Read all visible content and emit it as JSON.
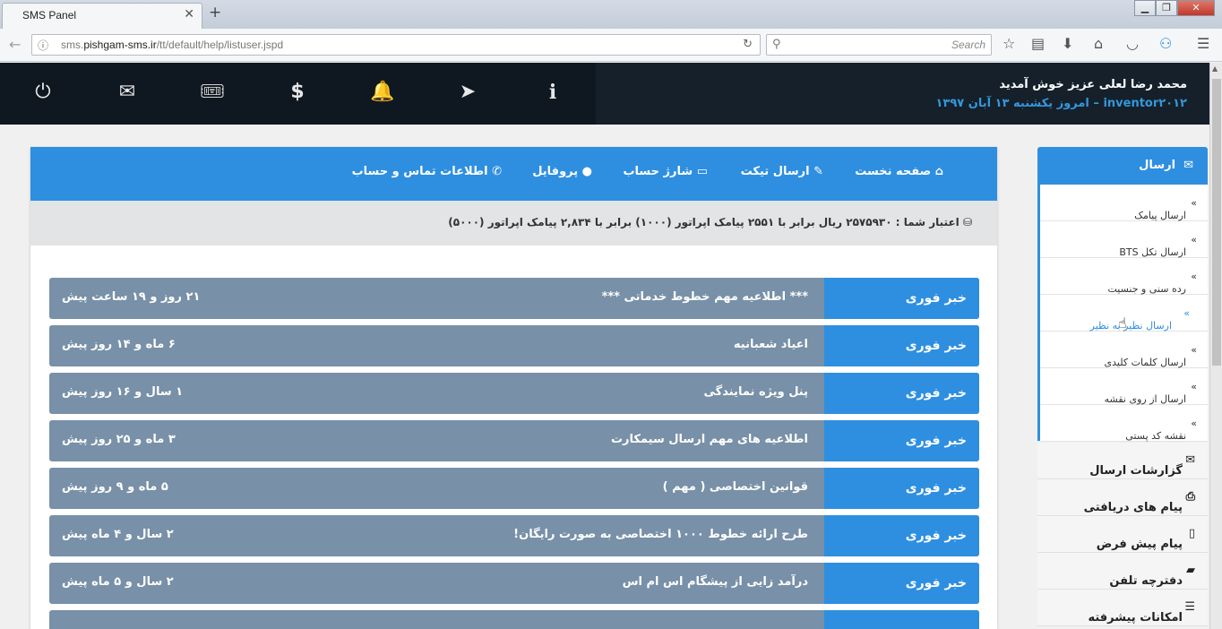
{
  "browser": {
    "tab_title": "SMS Panel",
    "tab_close": "✕",
    "new_tab": "+",
    "url_prefix": "sms.",
    "url_domain": "pishgam-sms.ir",
    "url_path": "/tt/default/help/listuser.jspd",
    "search_placeholder": "Search",
    "window_buttons": [
      "▁",
      "❐",
      "✕"
    ]
  },
  "header": {
    "welcome": "محمد رضا لعلی عزیز خوش آمدید",
    "today": "inventor۲۰۱۲ – امروز یکشنبه ۱۳ آبان ۱۳۹۷",
    "icons": [
      "power-icon",
      "envelope-icon",
      "ticket-icon",
      "dollar-icon",
      "bell-icon",
      "send-icon",
      "info-icon"
    ]
  },
  "topnav": {
    "home": "صفحه نخست",
    "ticket": "ارسال تیکت",
    "charge": "شارژ حساب",
    "profile": "پروفایل",
    "contact": "اطلاعات تماس و حساب"
  },
  "credit": "اعتبار شما : ۲۵۷۵۹۳۰ ریال برابر با ۲۵۵۱ پیامک اپراتور (۱۰۰۰) برابر با ۲,۸۳۴ پیامک اپراتور (۵۰۰۰)",
  "news": [
    {
      "label": "خبر فوری",
      "title": "*** اطلاعیه مهم خطوط خدماتی ***",
      "time": "۲۱ روز و ۱۹ ساعت پیش"
    },
    {
      "label": "خبر فوری",
      "title": "اعیاد شعبانیه",
      "time": "۶ ماه و ۱۴ روز پیش"
    },
    {
      "label": "خبر فوری",
      "title": "پنل ویژه نمایندگی",
      "time": "۱ سال و ۱۶ روز پیش"
    },
    {
      "label": "خبر فوری",
      "title": "اطلاعیه های مهم ارسال سیمکارت",
      "time": "۳ ماه و ۲۵ روز پیش"
    },
    {
      "label": "خبر فوری",
      "title": "قوانین اختصاصی ( مهم )",
      "time": "۵ ماه و ۹ روز پیش"
    },
    {
      "label": "خبر فوری",
      "title": "طرح ارائه خطوط ۱۰۰۰ اختصاصی به صورت رایگان!",
      "time": "۲ سال و ۴ ماه پیش"
    },
    {
      "label": "خبر فوری",
      "title": "درآمد زایی از پیشگام اس ام اس",
      "time": "۲ سال و ۵ ماه پیش"
    }
  ],
  "sidebar": {
    "head": "ارسال",
    "sub": [
      "ارسال پیامک",
      "ارسال تکل BTS",
      "رده سنی و جنسیت",
      "ارسال نظیر به نظیر",
      "ارسال کلمات کلیدی",
      "ارسال از روی نقشه",
      "نقشه کد پستی"
    ],
    "main": [
      "گزارشات ارسال",
      "پیام های دریافتی",
      "پیام پیش فرض",
      "دفترچه تلفن",
      "امکانات پیشرفته"
    ]
  },
  "colors": {
    "accent": "#2e8fe0",
    "news_bg": "#7890a8",
    "header_bg": "#15202b"
  }
}
